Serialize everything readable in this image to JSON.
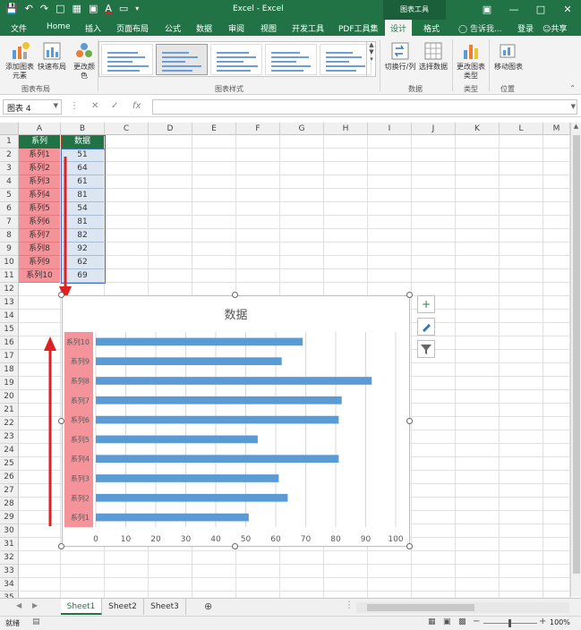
{
  "titlebar": {
    "title": "Excel - Excel",
    "context_group": "图表工具"
  },
  "tabs": {
    "file": "文件",
    "home": "Home",
    "insert": "插入",
    "page_layout": "页面布局",
    "formulas": "公式",
    "data": "数据",
    "review": "审阅",
    "view": "视图",
    "developer": "开发工具",
    "pdf": "PDF工具集",
    "design": "设计",
    "format": "格式",
    "tell_me": "告诉我...",
    "login": "登录",
    "share": "共享"
  },
  "ribbon": {
    "add_element": "添加图表元素",
    "quick_layout": "快速布局",
    "change_colors": "更改颜色",
    "group_layouts": "图表布局",
    "group_styles": "图表样式",
    "switch_row_col": "切换行/列",
    "select_data": "选择数据",
    "group_data": "数据",
    "change_type": "更改图表类型",
    "group_type": "类型",
    "move_chart": "移动图表",
    "group_location": "位置"
  },
  "formula_bar": {
    "name_box": "图表 4",
    "fx": "fx",
    "formula": ""
  },
  "columns": [
    "A",
    "B",
    "C",
    "D",
    "E",
    "F",
    "G",
    "H",
    "I",
    "J",
    "K",
    "L",
    "M"
  ],
  "rows": [
    "1",
    "2",
    "3",
    "4",
    "5",
    "6",
    "7",
    "8",
    "9",
    "10",
    "11",
    "12",
    "13",
    "14",
    "15",
    "16",
    "17",
    "18",
    "19",
    "20",
    "21",
    "22",
    "23",
    "24",
    "25",
    "26",
    "27",
    "28",
    "29",
    "30",
    "31",
    "32",
    "33",
    "34",
    "35"
  ],
  "table": {
    "header_a": "系列",
    "header_b": "数据",
    "labels": [
      "系列1",
      "系列2",
      "系列3",
      "系列4",
      "系列5",
      "系列6",
      "系列7",
      "系列8",
      "系列9",
      "系列10"
    ],
    "values": [
      "51",
      "64",
      "61",
      "81",
      "54",
      "81",
      "82",
      "92",
      "62",
      "69"
    ]
  },
  "chart_data": {
    "type": "bar",
    "orientation": "horizontal",
    "title": "数据",
    "categories": [
      "系列1",
      "系列2",
      "系列3",
      "系列4",
      "系列5",
      "系列6",
      "系列7",
      "系列8",
      "系列9",
      "系列10"
    ],
    "values": [
      51,
      64,
      61,
      81,
      54,
      81,
      82,
      92,
      62,
      69
    ],
    "xlim": [
      0,
      100
    ],
    "xticks": [
      "0",
      "10",
      "20",
      "30",
      "40",
      "50",
      "60",
      "70",
      "80",
      "90",
      "100"
    ],
    "grid": true,
    "bar_color": "#5b9bd5",
    "category_label_bg": "#f4949a"
  },
  "sheets": [
    "Sheet1",
    "Sheet2",
    "Sheet3"
  ],
  "status": {
    "ready": "就绪",
    "zoom": "100%"
  },
  "colors": {
    "excel_green": "#217346",
    "bar": "#5b9bd5",
    "highlight_red": "#f4949a",
    "arrow_red": "#e02020"
  }
}
